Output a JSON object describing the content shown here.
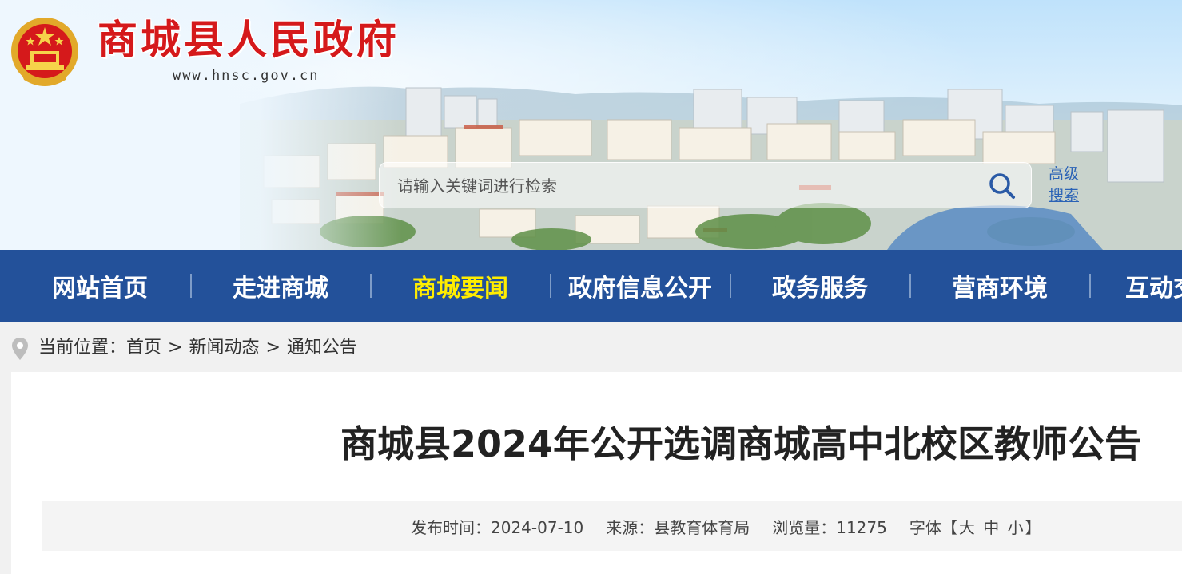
{
  "site": {
    "title": "商城县人民政府",
    "url": "www.hnsc.gov.cn"
  },
  "search": {
    "placeholder": "请输入关键词进行检索",
    "advanced_label": "高级搜索"
  },
  "nav": {
    "items": [
      {
        "label": "网站首页"
      },
      {
        "label": "走进商城"
      },
      {
        "label": "商城要闻",
        "active": true
      },
      {
        "label": "政府信息公开"
      },
      {
        "label": "政务服务"
      },
      {
        "label": "营商环境"
      },
      {
        "label": "互动交流"
      }
    ],
    "active_color": "#ffed00",
    "background": "#23519a"
  },
  "breadcrumb": {
    "prefix": "当前位置：",
    "items": [
      "首页",
      "新闻动态",
      "通知公告"
    ],
    "separator": ">"
  },
  "article": {
    "title": "商城县2024年公开选调商城高中北校区教师公告",
    "meta": {
      "publish_label": "发布时间：",
      "publish_date": "2024-07-10",
      "source_label": "来源：",
      "source": "县教育体育局",
      "views_label": "浏览量：",
      "views": "11275",
      "font_label": "字体【",
      "font_large": "大",
      "font_medium": "中",
      "font_small": "小",
      "font_close": "】"
    }
  },
  "icons": {
    "emblem": "national-emblem-icon",
    "search": "search-icon",
    "location": "location-pin-icon"
  },
  "colors": {
    "title_red": "#d5191b",
    "link_blue": "#2a62b6"
  }
}
